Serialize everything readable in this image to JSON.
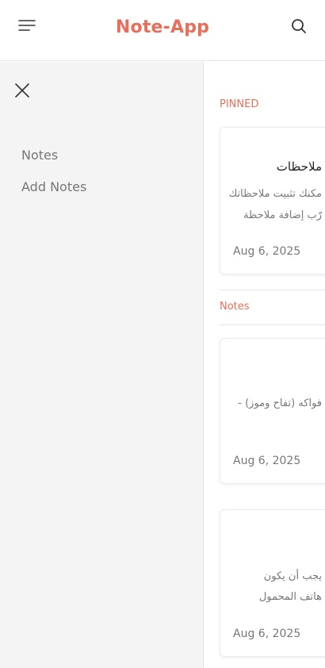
{
  "header": {
    "title": "Note-App"
  },
  "sidebar": {
    "items": [
      {
        "label": "Notes"
      },
      {
        "label": "Add Notes"
      }
    ]
  },
  "main": {
    "pinned_label": "PINNED",
    "notes_label": "Notes",
    "pinned_cards": [
      {
        "title": "ملاحظات",
        "lines": [
          "مكنك تثبيت ملاحظاتك",
          "رّب إضافة ملاحظة"
        ],
        "date": "Aug 6, 2025"
      }
    ],
    "note_cards": [
      {
        "lines": [
          "فواكه (تفاح وموز) -"
        ],
        "date": "Aug 6, 2025"
      },
      {
        "lines": [
          "يجب أن يكون",
          "هاتف المحمول"
        ],
        "date": "Aug 6, 2025"
      }
    ]
  },
  "colors": {
    "accent": "#e76f5a",
    "sidebar_bg": "#f4f4f4"
  },
  "icons": {
    "menu": "menu-icon",
    "search": "search-icon",
    "close": "close-icon"
  }
}
